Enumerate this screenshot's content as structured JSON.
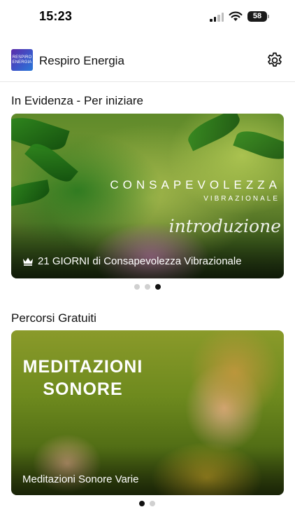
{
  "status_bar": {
    "time": "15:23",
    "battery": "58"
  },
  "header": {
    "logo_line1": "RESPIRO",
    "logo_line2": "ENERGIA",
    "title": "Respiro Energia"
  },
  "featured": {
    "section_title": "In Evidenza - Per iniziare",
    "card": {
      "headline": "CONSAPEVOLEZZA",
      "subheadline": "VIBRAZIONALE",
      "script_text": "introduzione",
      "caption": "21 GIORNI di Consapevolezza Vibrazionale"
    },
    "pager": {
      "count": 3,
      "active_index": 2
    }
  },
  "free_paths": {
    "section_title": "Percorsi Gratuiti",
    "card": {
      "headline_line1": "MEDITAZIONI",
      "headline_line2": "SONORE",
      "caption": "Meditazioni Sonore Varie"
    },
    "pager": {
      "count": 2,
      "active_index": 0
    }
  },
  "colors": {
    "accent": "#111111",
    "dot_inactive": "#d0d0d0",
    "divider": "#e6e6e6"
  },
  "icons": {
    "settings": "gear-icon",
    "premium": "crown-icon",
    "signal": "signal-icon",
    "wifi": "wifi-icon",
    "battery": "battery-icon"
  }
}
